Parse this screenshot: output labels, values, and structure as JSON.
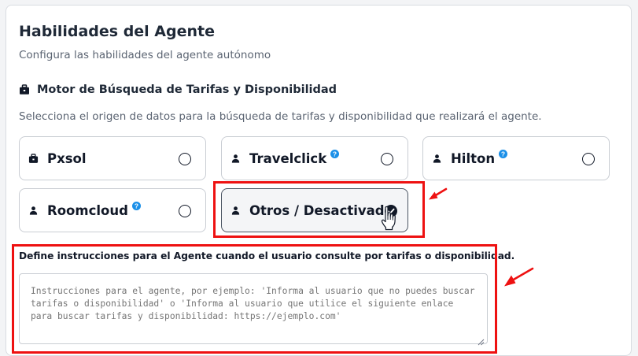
{
  "header": {
    "title": "Habilidades del Agente",
    "subtitle": "Configura las habilidades del agente autónomo"
  },
  "search_engine": {
    "title": "Motor de Búsqueda de Tarifas y Disponibilidad",
    "description": "Selecciona el origen de datos para la búsqueda de tarifas y disponibilidad que realizará el agente.",
    "options": [
      {
        "label": "Pxsol",
        "icon": "briefcase-icon",
        "has_help": false,
        "selected": false
      },
      {
        "label": "Travelclick",
        "icon": "person-icon",
        "has_help": true,
        "selected": false
      },
      {
        "label": "Hilton",
        "icon": "person-icon",
        "has_help": true,
        "selected": false
      },
      {
        "label": "Roomcloud",
        "icon": "person-icon",
        "has_help": true,
        "selected": false
      },
      {
        "label": "Otros / Desactivado",
        "icon": "person-icon",
        "has_help": false,
        "selected": true
      }
    ]
  },
  "instructions": {
    "label": "Define instrucciones para el Agente cuando el usuario consulte por tarifas o disponibilidad.",
    "placeholder": "Instrucciones para el agente, por ejemplo: 'Informa al usuario que no puedes buscar tarifas o disponibilidad' o 'Informa al usuario que utilice el siguiente enlace para buscar tarifas y disponibilidad: https://ejemplo.com'",
    "value": ""
  },
  "colors": {
    "annotation_red": "#ee1111",
    "help_icon_blue": "#1a8fe8",
    "text_dark": "#111827"
  }
}
